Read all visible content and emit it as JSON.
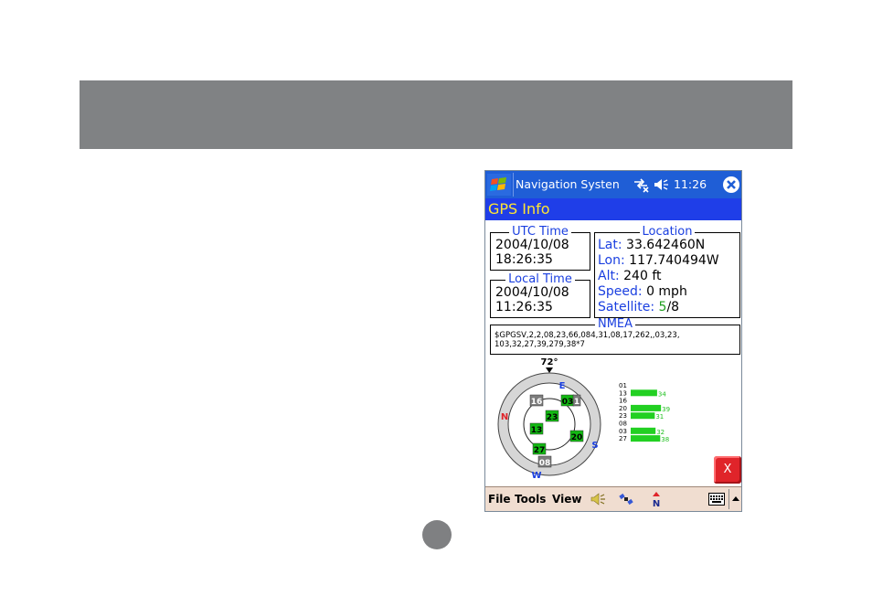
{
  "titlebar": {
    "app_title": "Navigation Systen",
    "time": "11:26"
  },
  "header": {
    "title": "GPS Info"
  },
  "utc": {
    "legend": "UTC Time",
    "date": "2004/10/08",
    "time": "18:26:35"
  },
  "local": {
    "legend": "Local Time",
    "date": "2004/10/08",
    "time": "11:26:35"
  },
  "location": {
    "legend": "Location",
    "lat_label": "Lat:",
    "lat_value": "33.642460N",
    "lon_label": "Lon:",
    "lon_value": "117.740494W",
    "alt_label": "Alt:",
    "alt_value": "240 ft",
    "speed_label": "Speed:",
    "speed_value": "0 mph",
    "satellite_label": "Satellite:",
    "satellite_used": "5",
    "satellite_total": "/8"
  },
  "nmea": {
    "legend": "NMEA",
    "sentence": "$GPGSV,2,2,08,23,66,084,31,08,17,262,,03,23,\n103,32,27,39,279,38*7"
  },
  "skyplot": {
    "heading": "72°",
    "compass": {
      "N": "N",
      "E": "E",
      "S": "S",
      "W": "W"
    },
    "satellites": [
      {
        "id": "16",
        "status": "gray"
      },
      {
        "id": "03",
        "status": "green"
      },
      {
        "id": "1",
        "status": "gray"
      },
      {
        "id": "23",
        "status": "green"
      },
      {
        "id": "13",
        "status": "green"
      },
      {
        "id": "20",
        "status": "green"
      },
      {
        "id": "27",
        "status": "green"
      },
      {
        "id": "08",
        "status": "gray"
      }
    ]
  },
  "signal": {
    "rows": [
      {
        "id": "01",
        "snr": ""
      },
      {
        "id": "13",
        "snr": "34"
      },
      {
        "id": "16",
        "snr": ""
      },
      {
        "id": "20",
        "snr": "39"
      },
      {
        "id": "23",
        "snr": "31"
      },
      {
        "id": "08",
        "snr": ""
      },
      {
        "id": "03",
        "snr": "32"
      },
      {
        "id": "27",
        "snr": "38"
      }
    ]
  },
  "close_label": "X",
  "menubar": {
    "file": "File",
    "tools": "Tools",
    "view": "View"
  },
  "colors": {
    "titlebar": "#1f5ed6",
    "header": "#1f3ee8",
    "header_text": "#ffe633",
    "label": "#1a3fe0",
    "signal": "#22d022",
    "close": "#e0242a"
  }
}
